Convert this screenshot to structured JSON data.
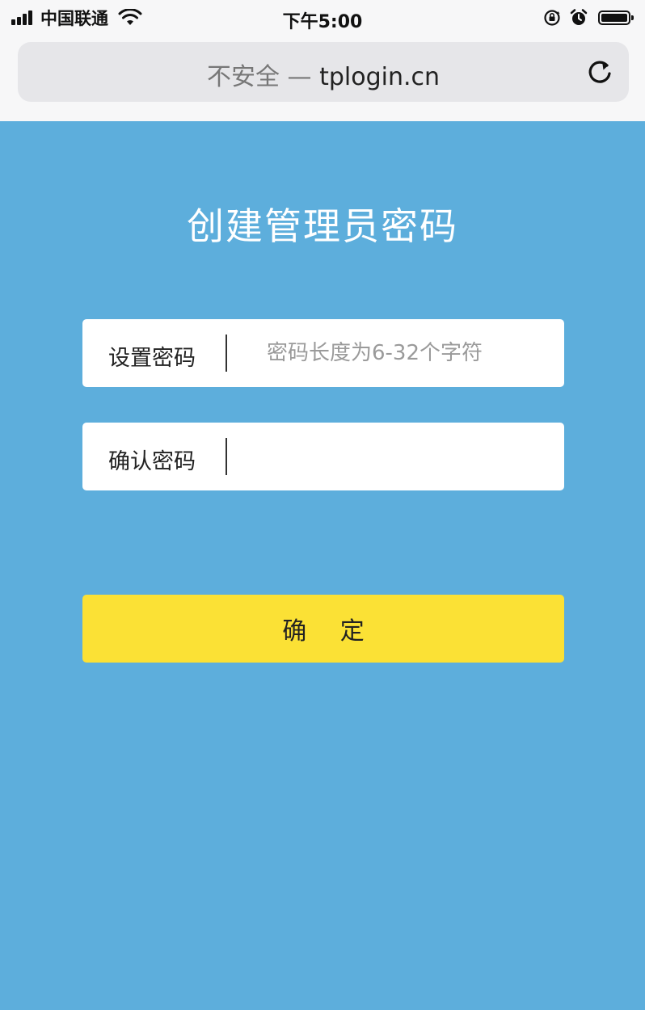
{
  "status_bar": {
    "carrier": "中国联通",
    "time": "下午5:00"
  },
  "browser": {
    "security": "不安全",
    "separator": "—",
    "domain": "tplogin.cn"
  },
  "page": {
    "title": "创建管理员密码",
    "password_field": {
      "label": "设置密码",
      "placeholder": "密码长度为6-32个字符",
      "value": ""
    },
    "confirm_field": {
      "label": "确认密码",
      "value": ""
    },
    "submit_label": "确 定"
  },
  "colors": {
    "background": "#5daedc",
    "button": "#fbe135",
    "field": "#ffffff",
    "title": "#ffffff"
  },
  "icons": [
    "signal-icon",
    "wifi-icon",
    "orientation-lock-icon",
    "alarm-icon",
    "battery-icon",
    "reload-icon"
  ]
}
